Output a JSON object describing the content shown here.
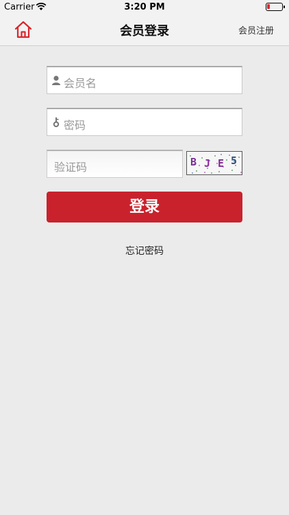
{
  "status_bar": {
    "carrier": "Carrier",
    "time": "3:20 PM"
  },
  "nav": {
    "title": "会员登录",
    "register_label": "会员注册",
    "home_icon": "home-icon"
  },
  "form": {
    "username_placeholder": "会员名",
    "password_placeholder": "密码",
    "captcha_placeholder": "验证码",
    "captcha_chars": [
      "B",
      "J",
      "E",
      "5"
    ],
    "login_label": "登录",
    "forgot_label": "忘记密码"
  },
  "colors": {
    "accent": "#c9222d",
    "nav_bg": "#f2f2f2",
    "page_bg": "#ebebeb"
  }
}
